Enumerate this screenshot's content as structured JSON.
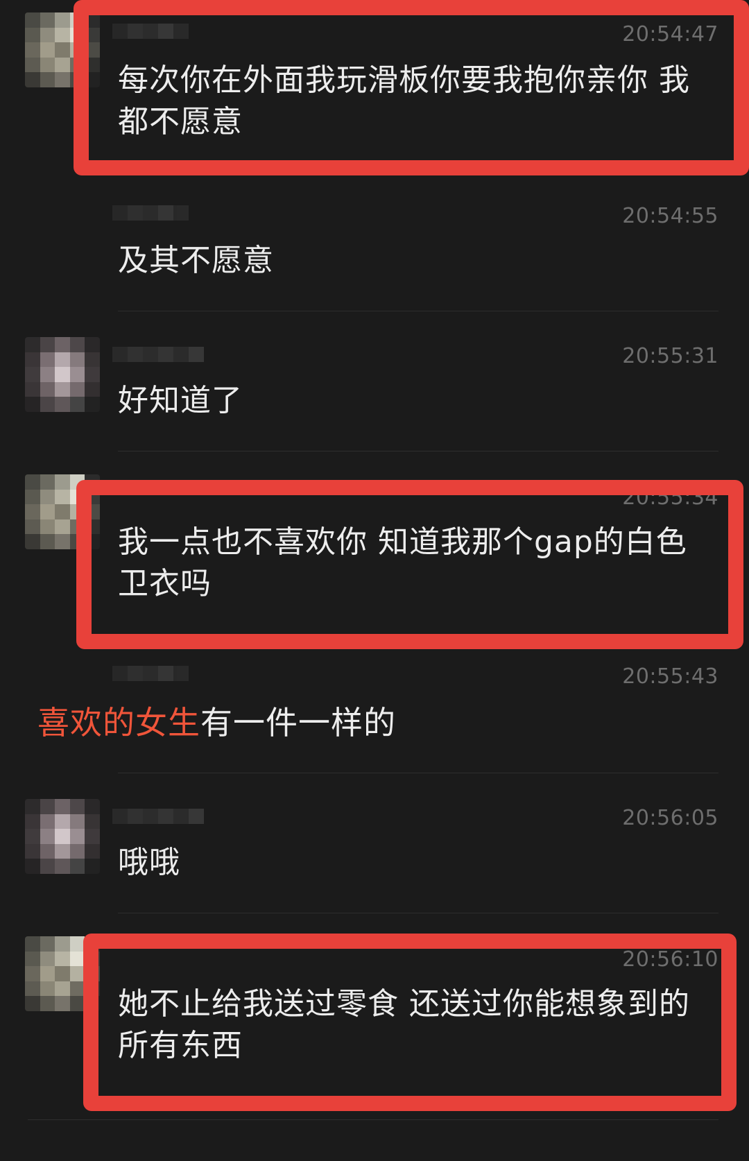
{
  "messages": [
    {
      "time": "20:54:47",
      "text": "每次你在外面我玩滑板你要我抱你亲你 我都不愿意"
    },
    {
      "time": "20:54:55",
      "text": "及其不愿意"
    },
    {
      "time": "20:55:31",
      "text": "好知道了"
    },
    {
      "time": "20:55:34",
      "text": "我一点也不喜欢你 知道我那个gap的白色卫衣吗"
    },
    {
      "time": "20:55:43",
      "text": ""
    },
    {
      "time": "20:56:05",
      "text": "哦哦"
    },
    {
      "time": "20:56:10",
      "text": "她不止给我送过零食 还送过你能想象到的所有东西"
    }
  ],
  "overlay": {
    "red_part": "喜欢的女生",
    "white_part": "有一件一样的"
  },
  "colors": {
    "background": "#1b1b1b",
    "highlight": "#e8413a",
    "overlay_red": "#f0553a",
    "timestamp": "#6e6e6e"
  }
}
